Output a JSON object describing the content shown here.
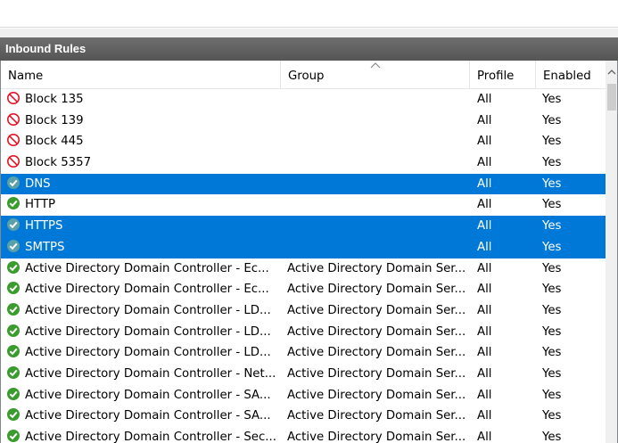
{
  "panel": {
    "title": "Inbound Rules"
  },
  "columns": {
    "name": "Name",
    "group": "Group",
    "profile": "Profile",
    "enabled": "Enabled"
  },
  "icons": {
    "block": "block-icon",
    "allow": "allow-check-icon"
  },
  "colors": {
    "selection": "#0078d7",
    "block": "#e81123",
    "allow": "#3a9b2e",
    "header": "#5f5f5f"
  },
  "rows": [
    {
      "name": "Block 135",
      "group": "",
      "profile": "All",
      "enabled": "Yes",
      "icon": "block",
      "selected": false
    },
    {
      "name": "Block 139",
      "group": "",
      "profile": "All",
      "enabled": "Yes",
      "icon": "block",
      "selected": false
    },
    {
      "name": "Block 445",
      "group": "",
      "profile": "All",
      "enabled": "Yes",
      "icon": "block",
      "selected": false
    },
    {
      "name": "Block 5357",
      "group": "",
      "profile": "All",
      "enabled": "Yes",
      "icon": "block",
      "selected": false
    },
    {
      "name": "DNS",
      "group": "",
      "profile": "All",
      "enabled": "Yes",
      "icon": "allow",
      "selected": true
    },
    {
      "name": "HTTP",
      "group": "",
      "profile": "All",
      "enabled": "Yes",
      "icon": "allow",
      "selected": false
    },
    {
      "name": "HTTPS",
      "group": "",
      "profile": "All",
      "enabled": "Yes",
      "icon": "allow",
      "selected": true
    },
    {
      "name": "SMTPS",
      "group": "",
      "profile": "All",
      "enabled": "Yes",
      "icon": "allow",
      "selected": true
    },
    {
      "name": "Active Directory Domain Controller -  Ec...",
      "group": "Active Directory Domain Ser...",
      "profile": "All",
      "enabled": "Yes",
      "icon": "allow",
      "selected": false
    },
    {
      "name": "Active Directory Domain Controller -  Ec...",
      "group": "Active Directory Domain Ser...",
      "profile": "All",
      "enabled": "Yes",
      "icon": "allow",
      "selected": false
    },
    {
      "name": "Active Directory Domain Controller - LD...",
      "group": "Active Directory Domain Ser...",
      "profile": "All",
      "enabled": "Yes",
      "icon": "allow",
      "selected": false
    },
    {
      "name": "Active Directory Domain Controller - LD...",
      "group": "Active Directory Domain Ser...",
      "profile": "All",
      "enabled": "Yes",
      "icon": "allow",
      "selected": false
    },
    {
      "name": "Active Directory Domain Controller - LD...",
      "group": "Active Directory Domain Ser...",
      "profile": "All",
      "enabled": "Yes",
      "icon": "allow",
      "selected": false
    },
    {
      "name": "Active Directory Domain Controller - Net...",
      "group": "Active Directory Domain Ser...",
      "profile": "All",
      "enabled": "Yes",
      "icon": "allow",
      "selected": false
    },
    {
      "name": "Active Directory Domain Controller - SA...",
      "group": "Active Directory Domain Ser...",
      "profile": "All",
      "enabled": "Yes",
      "icon": "allow",
      "selected": false
    },
    {
      "name": "Active Directory Domain Controller - SA...",
      "group": "Active Directory Domain Ser...",
      "profile": "All",
      "enabled": "Yes",
      "icon": "allow",
      "selected": false
    },
    {
      "name": "Active Directory Domain Controller - Sec...",
      "group": "Active Directory Domain Ser...",
      "profile": "All",
      "enabled": "Yes",
      "icon": "allow",
      "selected": false
    }
  ]
}
